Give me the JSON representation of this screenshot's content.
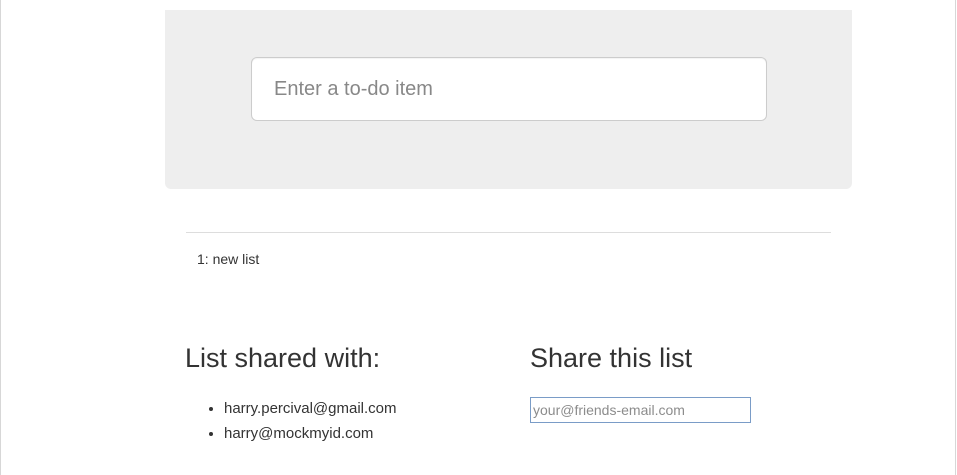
{
  "new_item": {
    "placeholder": "Enter a to-do item"
  },
  "list_table": {
    "rows": [
      {
        "text": "1: new list"
      }
    ]
  },
  "sharing": {
    "shared_with_heading": "List shared with:",
    "shared_with": [
      "harry.percival@gmail.com",
      "harry@mockmyid.com"
    ],
    "share_heading": "Share this list",
    "share_placeholder": "your@friends-email.com"
  }
}
